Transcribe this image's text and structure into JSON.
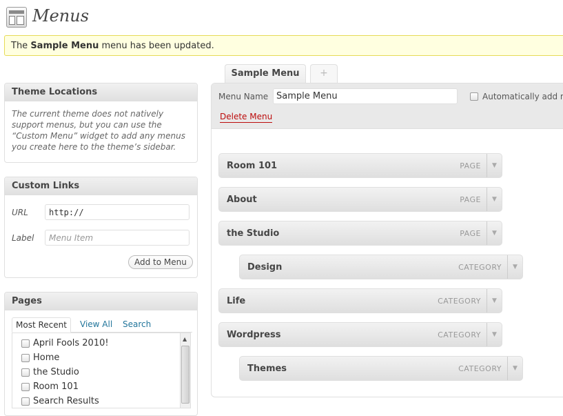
{
  "header": {
    "title": "Menus"
  },
  "notice": {
    "prefix": "The ",
    "menu_name": "Sample Menu",
    "suffix": " menu has been updated."
  },
  "theme_locations": {
    "title": "Theme Locations",
    "text": "The current theme does not natively support menus, but you can use the “Custom Menu” widget to add any menus you create here to the theme’s sidebar."
  },
  "custom_links": {
    "title": "Custom Links",
    "url_label": "URL",
    "url_value": "http://",
    "label_label": "Label",
    "label_placeholder": "Menu Item",
    "add_button": "Add to Menu"
  },
  "pages": {
    "title": "Pages",
    "tabs": [
      "Most Recent",
      "View All",
      "Search"
    ],
    "items": [
      "April Fools 2010!",
      "Home",
      "the Studio",
      "Room 101",
      "Search Results"
    ]
  },
  "menu_editor": {
    "tab_label": "Sample Menu",
    "add_tab_label": "+",
    "name_label": "Menu Name",
    "name_value": "Sample Menu",
    "auto_add_label": "Automatically add ne",
    "delete_label": "Delete Menu",
    "items": [
      {
        "title": "Room 101",
        "type": "PAGE",
        "depth": 0
      },
      {
        "title": "About",
        "type": "PAGE",
        "depth": 0
      },
      {
        "title": "the Studio",
        "type": "PAGE",
        "depth": 0
      },
      {
        "title": "Design",
        "type": "CATEGORY",
        "depth": 1
      },
      {
        "title": "Life",
        "type": "CATEGORY",
        "depth": 0
      },
      {
        "title": "Wordpress",
        "type": "CATEGORY",
        "depth": 0
      },
      {
        "title": "Themes",
        "type": "CATEGORY",
        "depth": 1
      }
    ]
  },
  "icons": {
    "dropdown": "▼",
    "scroll_up": "▲"
  }
}
